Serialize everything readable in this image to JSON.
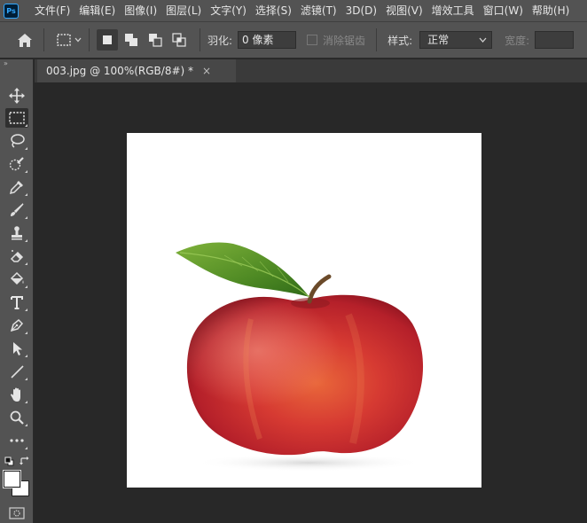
{
  "menubar": {
    "logo": "Ps",
    "items": [
      "文件(F)",
      "编辑(E)",
      "图像(I)",
      "图层(L)",
      "文字(Y)",
      "选择(S)",
      "滤镜(T)",
      "3D(D)",
      "视图(V)",
      "增效工具",
      "窗口(W)",
      "帮助(H)"
    ]
  },
  "options": {
    "feather_label": "羽化:",
    "feather_value": "0 像素",
    "antialias_label": "消除锯齿",
    "style_label": "样式:",
    "style_value": "正常",
    "width_label": "宽度:"
  },
  "tabs": {
    "doc_title": "003.jpg @ 100%(RGB/8#) *",
    "close": "×"
  },
  "toolbar": {
    "collapse": "»",
    "tools": [
      "move-tool",
      "rectangular-marquee-tool",
      "lasso-tool",
      "quick-selection-tool",
      "eyedropper-tool",
      "brush-tool",
      "clone-stamp-tool",
      "eraser-tool",
      "paint-bucket-tool",
      "type-tool",
      "pen-tool",
      "path-selection-tool",
      "line-tool",
      "hand-tool",
      "zoom-tool",
      "more-tools"
    ]
  },
  "colors": {
    "foreground": "#ffffff",
    "background": "#ffffff",
    "accent": "#31a8ff"
  },
  "canvas": {
    "image_subject": "red apple with leaf"
  }
}
